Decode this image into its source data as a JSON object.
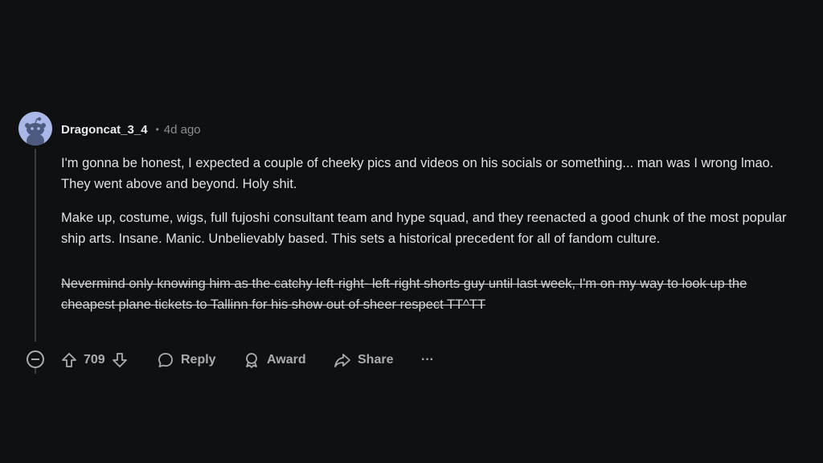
{
  "comment": {
    "username": "Dragoncat_3_4",
    "separator": "•",
    "timestamp": "4d ago",
    "paragraphs": [
      "I'm gonna be honest, I expected a couple of cheeky pics and videos on his socials or something... man was I wrong lmao. They went above and beyond. Holy shit.",
      "Make up, costume, wigs, full fujoshi consultant team and hype squad, and they reenacted a good chunk of the most popular ship arts. Insane. Manic. Unbelievably based. This sets a historical precedent for all of fandom culture."
    ],
    "strikethrough_paragraph": "Nevermind only knowing him as the catchy left-right- left-right shorts guy until last week, I'm on my way to look up the cheapest plane tickets to Tallinn for his show out of sheer respect TT^TT",
    "votes": "709"
  },
  "actions": {
    "reply": "Reply",
    "award": "Award",
    "share": "Share",
    "more": "···"
  },
  "icons": {
    "avatar": "snoo-avatar-icon",
    "collapse": "collapse-icon",
    "upvote": "upvote-arrow-icon",
    "downvote": "downvote-arrow-icon",
    "reply": "speech-bubble-icon",
    "award": "award-icon",
    "share": "share-arrow-icon"
  },
  "colors": {
    "background": "#0f1011",
    "avatar_bg": "#a9b8e8",
    "text": "#e0e3e6",
    "muted": "#8b8f93"
  }
}
